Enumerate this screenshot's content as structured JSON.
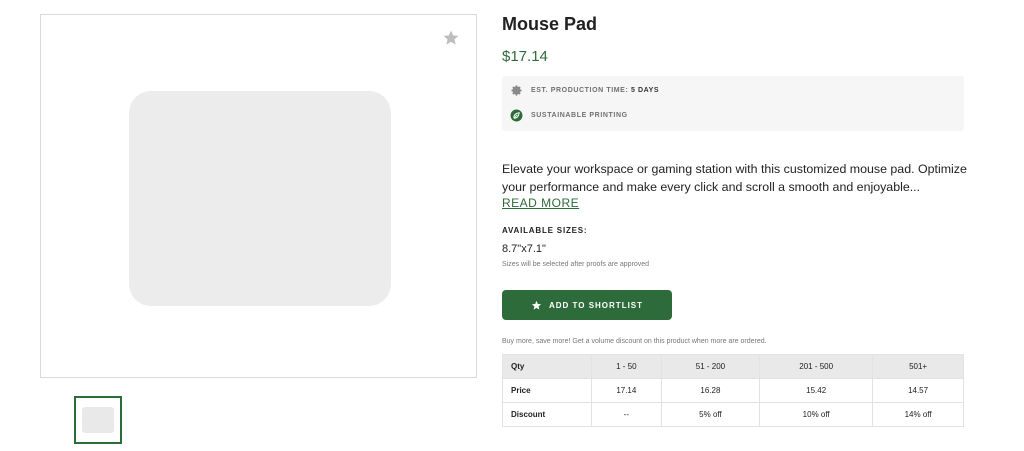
{
  "product": {
    "title": "Mouse Pad",
    "price": "$17.14",
    "features": [
      {
        "icon": "gear-icon",
        "label": "EST. PRODUCTION TIME:",
        "value": "5 DAYS"
      },
      {
        "icon": "leaf-icon",
        "label": "SUSTAINABLE PRINTING"
      }
    ],
    "description": "Elevate your workspace or gaming station with this customized mouse pad. Optimize your performance and make every click and scroll a smooth and enjoyable...",
    "read_more": "READ MORE",
    "sizes": {
      "heading": "AVAILABLE SIZES:",
      "value": "8.7\"x7.1\"",
      "note": "Sizes will be selected after proofs are approved"
    },
    "shortlist_button": "ADD TO SHORTLIST",
    "volume_note": "Buy more, save more! Get a volume discount on this product when more are ordered."
  },
  "pricing_table": {
    "header": [
      "Qty",
      "1 - 50",
      "51 - 200",
      "201 - 500",
      "501+"
    ],
    "rows": [
      [
        "Price",
        "17.14",
        "16.28",
        "15.42",
        "14.57"
      ],
      [
        "Discount",
        "--",
        "5% off",
        "10% off",
        "14% off"
      ]
    ]
  },
  "colors": {
    "accent": "#2e6b3a",
    "feature_bg": "#f6f6f6",
    "table_header_bg": "#e9e9e9"
  }
}
